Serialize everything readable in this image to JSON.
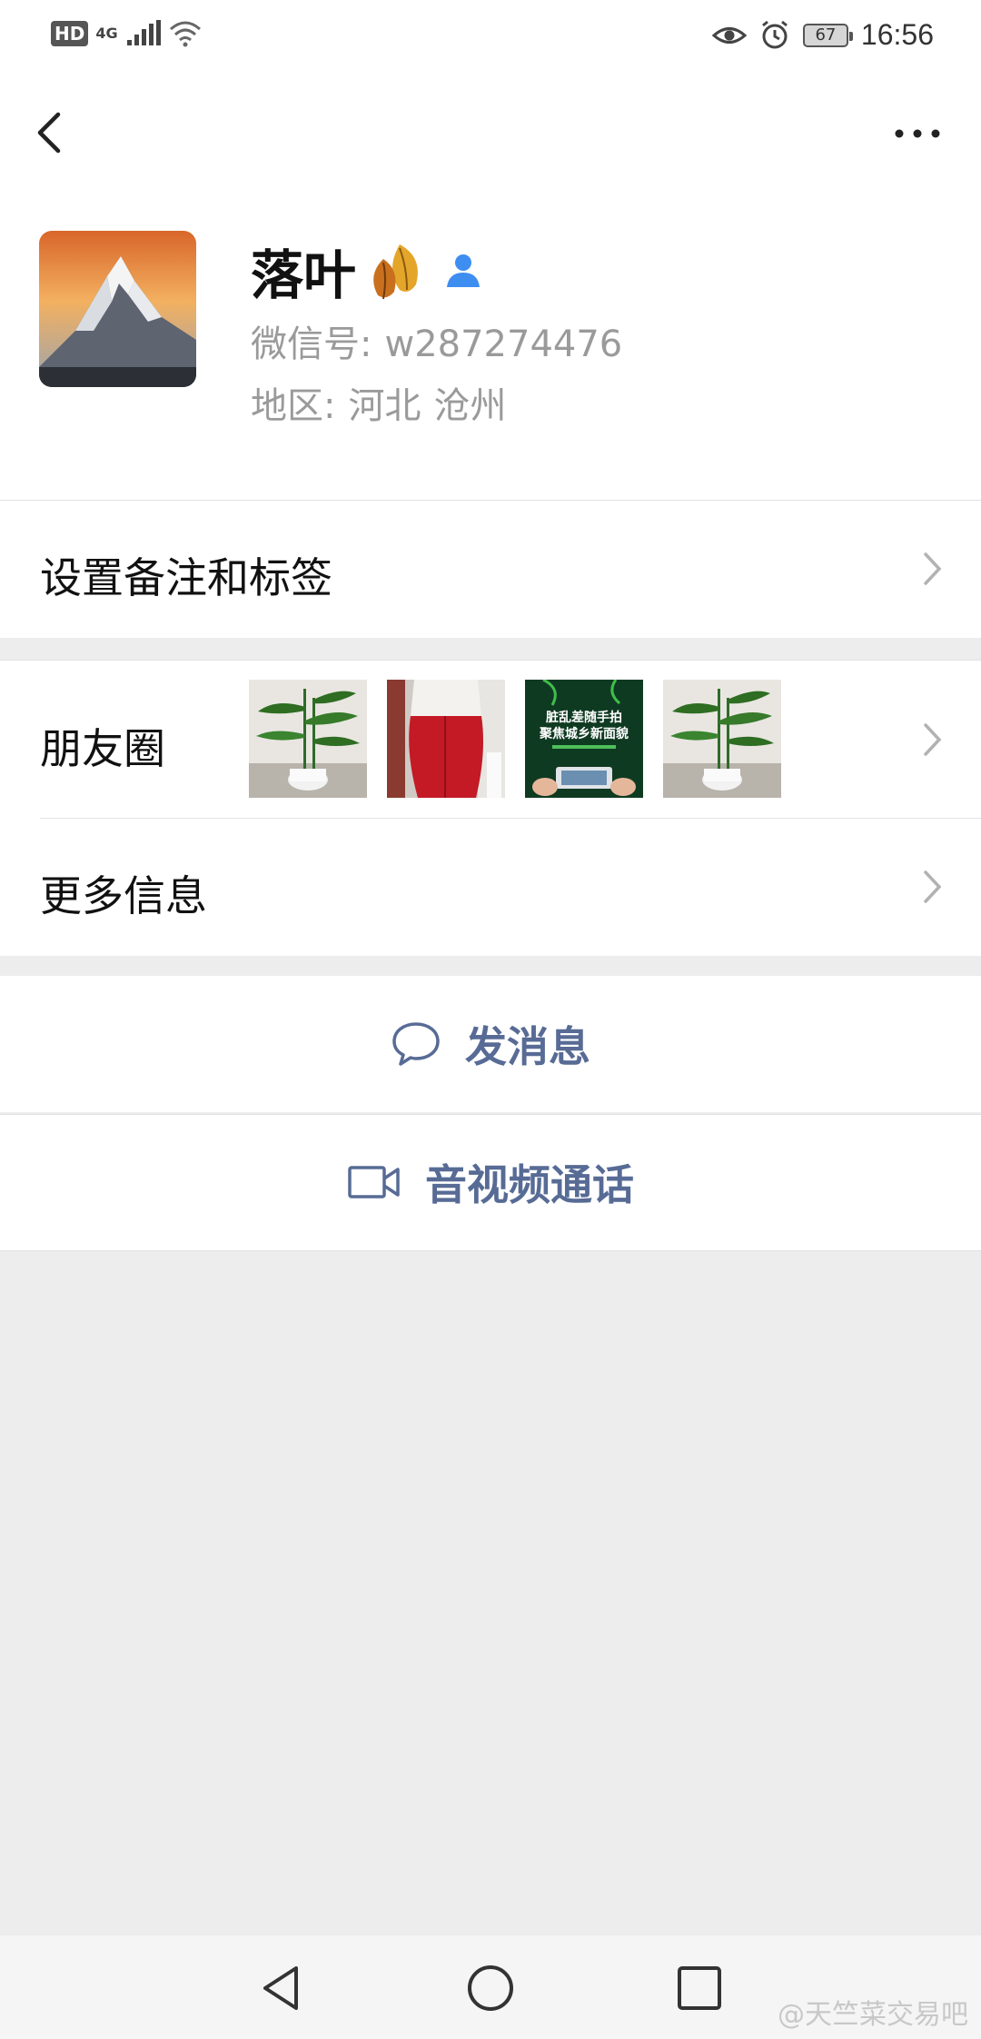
{
  "status_bar": {
    "hd_badge": "HD",
    "network": "4G",
    "time": "16:56",
    "battery": "67"
  },
  "profile": {
    "name": "落叶",
    "wechat_id_label": "微信号:",
    "wechat_id": "w287274476",
    "region_label": "地区:",
    "region_province": "河北",
    "region_city": "沧州"
  },
  "cells": {
    "remarks_tags": "设置备注和标签",
    "moments": "朋友圈",
    "more_info": "更多信息"
  },
  "moments_thumbs": {
    "poster_line1": "脏乱差随手拍",
    "poster_line2": "聚焦城乡新面貌"
  },
  "actions": {
    "send_message": "发消息",
    "video_call": "音视频通话"
  },
  "watermark": "@天竺菜交易吧",
  "colors": {
    "link": "#576b95",
    "background": "#ededed",
    "badge_blue": "#3d8ef0"
  }
}
